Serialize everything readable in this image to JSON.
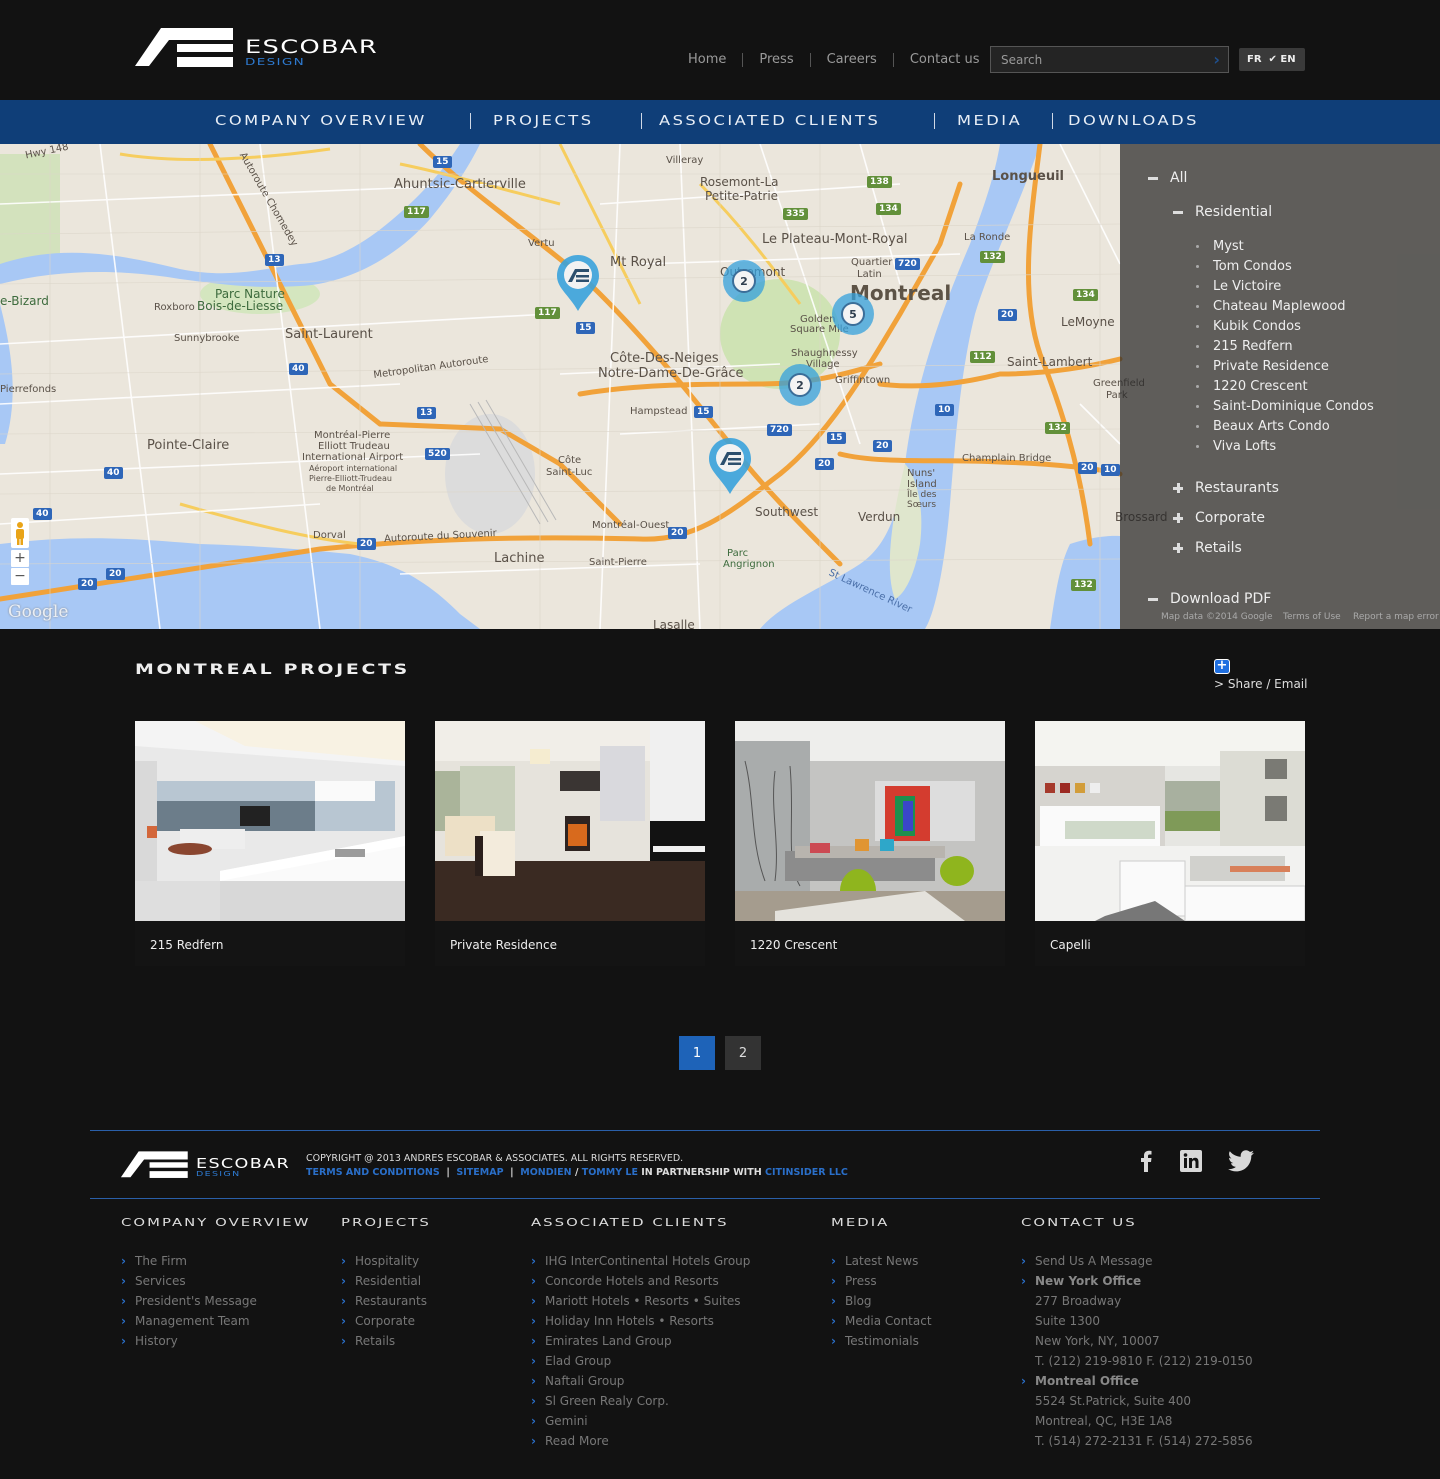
{
  "brand": {
    "name": "ESCOBAR",
    "sub": "DESIGN",
    "accent": "#2e7ad0"
  },
  "topnav": {
    "items": [
      "Home",
      "Press",
      "Careers",
      "Contact us"
    ]
  },
  "search": {
    "placeholder": "Search",
    "value": ""
  },
  "lang": {
    "fr": "FR",
    "en": "EN",
    "selected": "EN"
  },
  "mainnav": {
    "items": [
      "COMPANY OVERVIEW",
      "PROJECTS",
      "ASSOCIATED CLIENTS",
      "MEDIA",
      "DOWNLOADS"
    ],
    "bg": "#0f3e78"
  },
  "map": {
    "labels": {
      "ahuntsic": "Ahuntsic-Cartierville",
      "rosemont": "Rosemont-La",
      "rosemont2": "Petite-Patrie",
      "villeray": "Villeray",
      "longueuil": "Longueuil",
      "plateau": "Le Plateau-Mont-Royal",
      "mtroyal": "Mt Royal",
      "vertu": "Vertu",
      "quartier": "Quartier",
      "latin": "Latin",
      "montreal": "Montreal",
      "laronde": "La Ronde",
      "outremont": "Outremont",
      "golden": "Golden",
      "squaremile": "Square Mile",
      "parcnature": "Parc Nature",
      "boisdeliesse": "Bois-de-Liesse",
      "roxboro": "Roxboro",
      "sunnybrooke": "Sunnybrooke",
      "saintlaurent": "Saint-Laurent",
      "cotedesneiges": "Côte-Des-Neiges",
      "ndg": "Notre-Dame-De-Grâce",
      "shaughnessy": "Shaughnessy",
      "village": "Village",
      "griffintown": "Griffintown",
      "saintlambert": "Saint-Lambert",
      "lemoyne": "LeMoyne",
      "hampstead": "Hampstead",
      "pierrefonds": "Pierrefonds",
      "pointeclaire": "Pointe-Claire",
      "airport1": "Montréal-Pierre",
      "airport2": "Elliott Trudeau",
      "airport3": "International Airport",
      "airport4": "Aéroport international",
      "airport5": "Pierre-Elliott-Trudeau",
      "airport6": "de Montréal",
      "cotesaintluc1": "Côte",
      "cotesaintluc2": "Saint-Luc",
      "southwest": "Southwest",
      "verdun": "Verdun",
      "nuns1": "Nuns'",
      "nuns2": "Island",
      "nuns3": "Île des",
      "nuns4": "Sœurs",
      "champlain": "Champlain Bridge",
      "lachine": "Lachine",
      "dorval": "Dorval",
      "montrealouest": "Montréal-Ouest",
      "saintpierre": "Saint-Pierre",
      "parcangrignon1": "Parc",
      "parcangrignon2": "Angrignon",
      "lasalle": "Lasalle",
      "brossard": "Brossard",
      "stlawrence": "St Lawrence River",
      "metropolitan": "Metropolitan Autoroute",
      "chomedey": "Autoroute Chomedey",
      "souvenir": "Autoroute du Souvenir",
      "bizard": "e-Bizard",
      "greenfield": "Greenfield",
      "park": "Park",
      "hwy148": "Hwy 148"
    },
    "clusters": [
      2,
      5,
      2
    ],
    "controls": {
      "zoom_in": "+",
      "zoom_out": "−"
    },
    "google": "Google",
    "footer": {
      "data": "Map data ©2014 Google",
      "terms": "Terms of Use",
      "report": "Report a map error"
    }
  },
  "filter": {
    "all": "All",
    "residential": "Residential",
    "residential_items": [
      "Myst",
      "Tom Condos",
      "Le Victoire",
      "Chateau Maplewood",
      "Kubik Condos",
      "215 Redfern",
      "Private Residence",
      "1220 Crescent",
      "Saint-Dominique Condos",
      "Beaux Arts Condo",
      "Viva Lofts"
    ],
    "collapsed": [
      "Restaurants",
      "Corporate",
      "Retails"
    ],
    "download": "Download PDF"
  },
  "projects": {
    "title": "MONTREAL PROJECTS",
    "share": "> Share / Email",
    "share_icon": "+",
    "cards": [
      {
        "name": "215 Redfern"
      },
      {
        "name": "Private Residence"
      },
      {
        "name": "1220 Crescent"
      },
      {
        "name": "Capelli"
      }
    ]
  },
  "pagination": {
    "pages": [
      "1",
      "2"
    ],
    "current": "1"
  },
  "footer": {
    "copyright": "COPYRIGHT @ 2013 ANDRES ESCOBAR & ASSOCIATES. ALL RIGHTS RESERVED.",
    "terms": "TERMS AND CONDITIONS",
    "sitemap": "SITEMAP",
    "mondien": "MONDIEN",
    "slash": "/",
    "tommy": "TOMMY LE",
    "partnership": "IN PARTNERSHIP WITH",
    "citinsider": "CITINSIDER LLC",
    "pipe": "|",
    "social": [
      "facebook",
      "linkedin",
      "twitter"
    ],
    "columns": {
      "company": {
        "title": "COMPANY OVERVIEW",
        "items": [
          "The Firm",
          "Services",
          "President's Message",
          "Management Team",
          "History"
        ]
      },
      "projects": {
        "title": "PROJECTS",
        "items": [
          "Hospitality",
          "Residential",
          "Restaurants",
          "Corporate",
          "Retails"
        ]
      },
      "clients": {
        "title": "ASSOCIATED CLIENTS",
        "items": [
          "IHG InterContinental Hotels Group",
          "Concorde Hotels and Resorts",
          "Mariott Hotels • Resorts • Suites",
          "Holiday Inn Hotels • Resorts",
          "Emirates Land Group",
          "Elad Group",
          "Naftali Group",
          "Sl Green Realy Corp.",
          "Gemini",
          "Read More"
        ]
      },
      "media": {
        "title": "MEDIA",
        "items": [
          "Latest News",
          "Press",
          "Blog",
          "Media Contact",
          "Testimonials"
        ]
      },
      "contact": {
        "title": "CONTACT US",
        "send": "Send Us A Message",
        "ny_title": "New York Office",
        "ny_lines": [
          "277 Broadway",
          "Suite 1300",
          "New York, NY, 10007",
          "T. (212) 219-9810 F. (212) 219-0150"
        ],
        "mtl_title": "Montreal Office",
        "mtl_lines": [
          "5524 St.Patrick, Suite 400",
          "Montreal, QC, H3E 1A8",
          "T. (514) 272-2131 F. (514) 272-5856"
        ]
      }
    }
  }
}
